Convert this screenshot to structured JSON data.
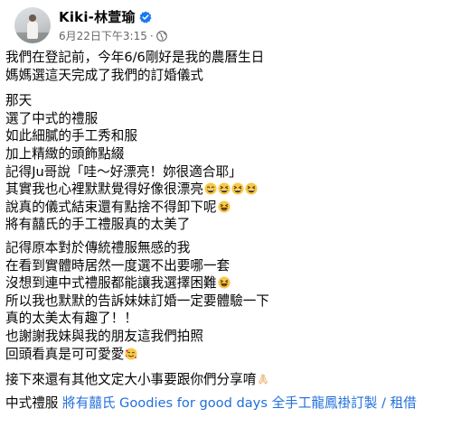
{
  "post": {
    "author": "Kiki-林萱瑜",
    "timestamp": "6月22日下午3:15",
    "separator": "·",
    "icons": {
      "verified": "verified-badge-icon",
      "audience": "public-globe-icon",
      "avatar": "profile-photo"
    },
    "lines": {
      "l1": "我們在登記前，今年6/6剛好是我的農曆生日",
      "l2": "媽媽選這天完成了我們的訂婚儀式",
      "l3": "那天",
      "l4": "選了中式的禮服",
      "l5": "如此細膩的手工秀和服",
      "l6": "加上精緻的頭飾點綴",
      "l7": "記得Ju哥說「哇～好漂亮！妳很適合耶」",
      "l8": "其實我也心裡默默覺得好像很漂亮",
      "l9": "說真的儀式結束還有點捨不得卸下呢",
      "l10": "將有囍氏的手工禮服真的太美了",
      "l11": "記得原本對於傳統禮服無感的我",
      "l12": "在看到實體時居然一度選不出要哪一套",
      "l13": "沒想到連中式禮服都能讓我選擇困難",
      "l14": "所以我也默默的告訴妹妹訂婚一定要體驗一下",
      "l15": "真的太美太有趣了！！",
      "l16": "也謝謝我妹與我的朋友這我們拍照",
      "l17": "回頭看真是可可愛愛",
      "l18": "接下來還有其他文定大小事要跟你們分享唷",
      "tag_prefix": "中式禮服",
      "tag_link": "將有囍氏 Goodies for good days 全手工龍鳳褂訂製 / 租借"
    },
    "emojis": {
      "l8": [
        "grinning-face-smiling-eyes",
        "laughing-face",
        "laughing-face",
        "laughing-face"
      ],
      "l9": "grinning-squinting-face",
      "l13": "grinning-squinting-face",
      "l17": "smiling-face-with-hearts",
      "l18": "folded-hands"
    },
    "colors": {
      "link": "#216fdb",
      "meta": "#65676b",
      "text": "#050505",
      "verified": "#1877f2"
    }
  }
}
